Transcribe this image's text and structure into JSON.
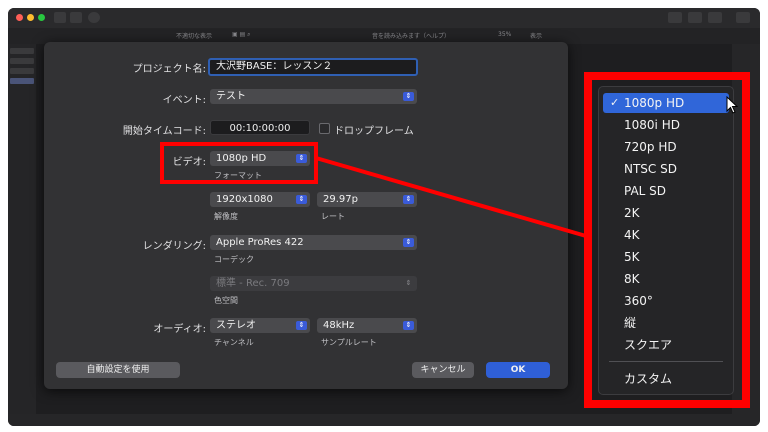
{
  "toolbar": {
    "left_label": "不適切な表示",
    "center_label": "音を読み込みます（ヘルプ）",
    "zoom": "35%",
    "view_label": "表示"
  },
  "dialog": {
    "project_name_label": "プロジェクト名:",
    "project_name_value": "大沢野BASE：レッスン２",
    "event_label": "イベント:",
    "event_value": "テスト",
    "timecode_label": "開始タイムコード:",
    "timecode_value": "00:10:00:00",
    "dropframe_label": "ドロップフレーム",
    "video_label": "ビデオ:",
    "format_value": "1080p HD",
    "format_sublabel": "フォーマット",
    "resolution_value": "1920x1080",
    "resolution_sublabel": "解像度",
    "rate_value": "29.97p",
    "rate_sublabel": "レート",
    "rendering_label": "レンダリング:",
    "codec_value": "Apple ProRes 422",
    "codec_sublabel": "コーデック",
    "colorspace_value": "標準 - Rec. 709",
    "colorspace_sublabel": "色空間",
    "audio_label": "オーディオ:",
    "channel_value": "ステレオ",
    "channel_sublabel": "チャンネル",
    "samplerate_value": "48kHz",
    "samplerate_sublabel": "サンプルレート",
    "auto_settings_button": "自動設定を使用",
    "cancel_button": "キャンセル",
    "ok_button": "OK"
  },
  "format_menu": {
    "check": "✓",
    "items": [
      "1080p HD",
      "1080i HD",
      "720p HD",
      "NTSC SD",
      "PAL SD",
      "2K",
      "4K",
      "5K",
      "8K",
      "360°",
      "縦",
      "スクエア"
    ],
    "custom": "カスタム",
    "selected": "1080p HD"
  },
  "colors": {
    "highlight": "#ff0000",
    "accent": "#3066d9"
  }
}
